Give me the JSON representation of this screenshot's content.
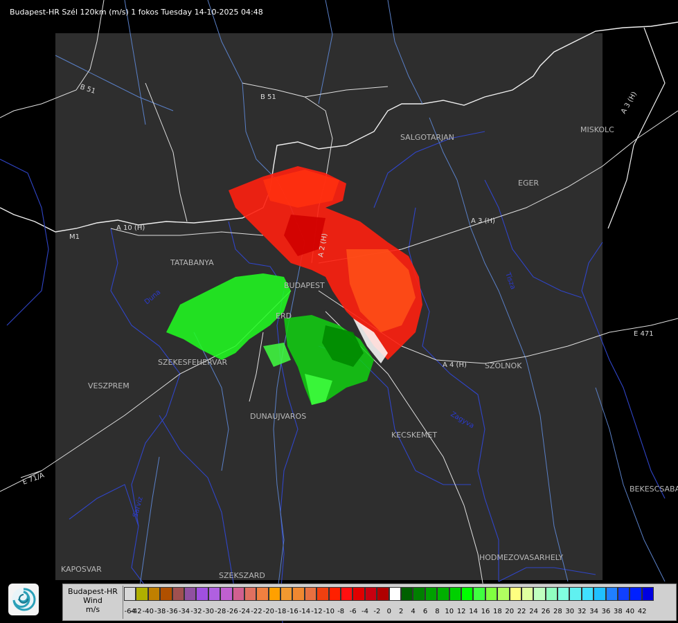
{
  "title": "Budapest-HR Szél 120km (m/s) 1 fokos Tuesday 14-10-2025 04:48",
  "cities": [
    "SALGOTARJAN",
    "MISKOLC",
    "EGER",
    "TATABANYA",
    "BUDAPEST",
    "ERD",
    "SZEKESFEHERVAR",
    "VESZPREM",
    "SZOLNOK",
    "DUNAUJVAROS",
    "KECSKEMET",
    "BEKESCSABA",
    "HODMEZOVASARHELY",
    "KAPOSVAR",
    "SZEKSZARD"
  ],
  "roads": [
    "B 51",
    "B 51",
    "A 3 (H)",
    "A 3 (H)",
    "A 2 (H)",
    "A 4 (H)",
    "E 471",
    "A 10 (H)",
    "M1",
    "E 71/A"
  ],
  "rivers": [
    "Duna",
    "Tisza",
    "Sarviz",
    "Zagyva"
  ],
  "legend": {
    "title_lines": [
      "Budapest-HR",
      "Wind",
      "m/s"
    ],
    "ticks": [
      "-64",
      "-42",
      "-40",
      "-38",
      "-36",
      "-34",
      "-32",
      "-30",
      "-28",
      "-26",
      "-24",
      "-22",
      "-20",
      "-18",
      "-16",
      "-14",
      "-12",
      "-10",
      "-8",
      "-6",
      "-4",
      "-2",
      "0",
      "2",
      "4",
      "6",
      "8",
      "10",
      "12",
      "14",
      "16",
      "18",
      "20",
      "22",
      "24",
      "26",
      "28",
      "30",
      "32",
      "34",
      "36",
      "38",
      "40",
      "42"
    ],
    "colors": [
      "#d8d8d8",
      "#b0b000",
      "#c08000",
      "#b05000",
      "#a05050",
      "#9050a0",
      "#a050e0",
      "#b060e0",
      "#c060d0",
      "#d06090",
      "#e07060",
      "#f08040",
      "#ffa000",
      "#f09830",
      "#f08830",
      "#e87040",
      "#f04010",
      "#ff2000",
      "#ff1010",
      "#e00000",
      "#c80010",
      "#b00000",
      "#ffffff",
      "#006000",
      "#008000",
      "#00a000",
      "#00b000",
      "#00d000",
      "#00ff00",
      "#40ff40",
      "#80ff40",
      "#b0ff60",
      "#ffff80",
      "#e0ffa0",
      "#c0ffc0",
      "#90ffc0",
      "#80ffe0",
      "#60f0f0",
      "#40e0ff",
      "#20c0ff",
      "#2080ff",
      "#1040ff",
      "#0020ff",
      "#0000e0"
    ]
  }
}
